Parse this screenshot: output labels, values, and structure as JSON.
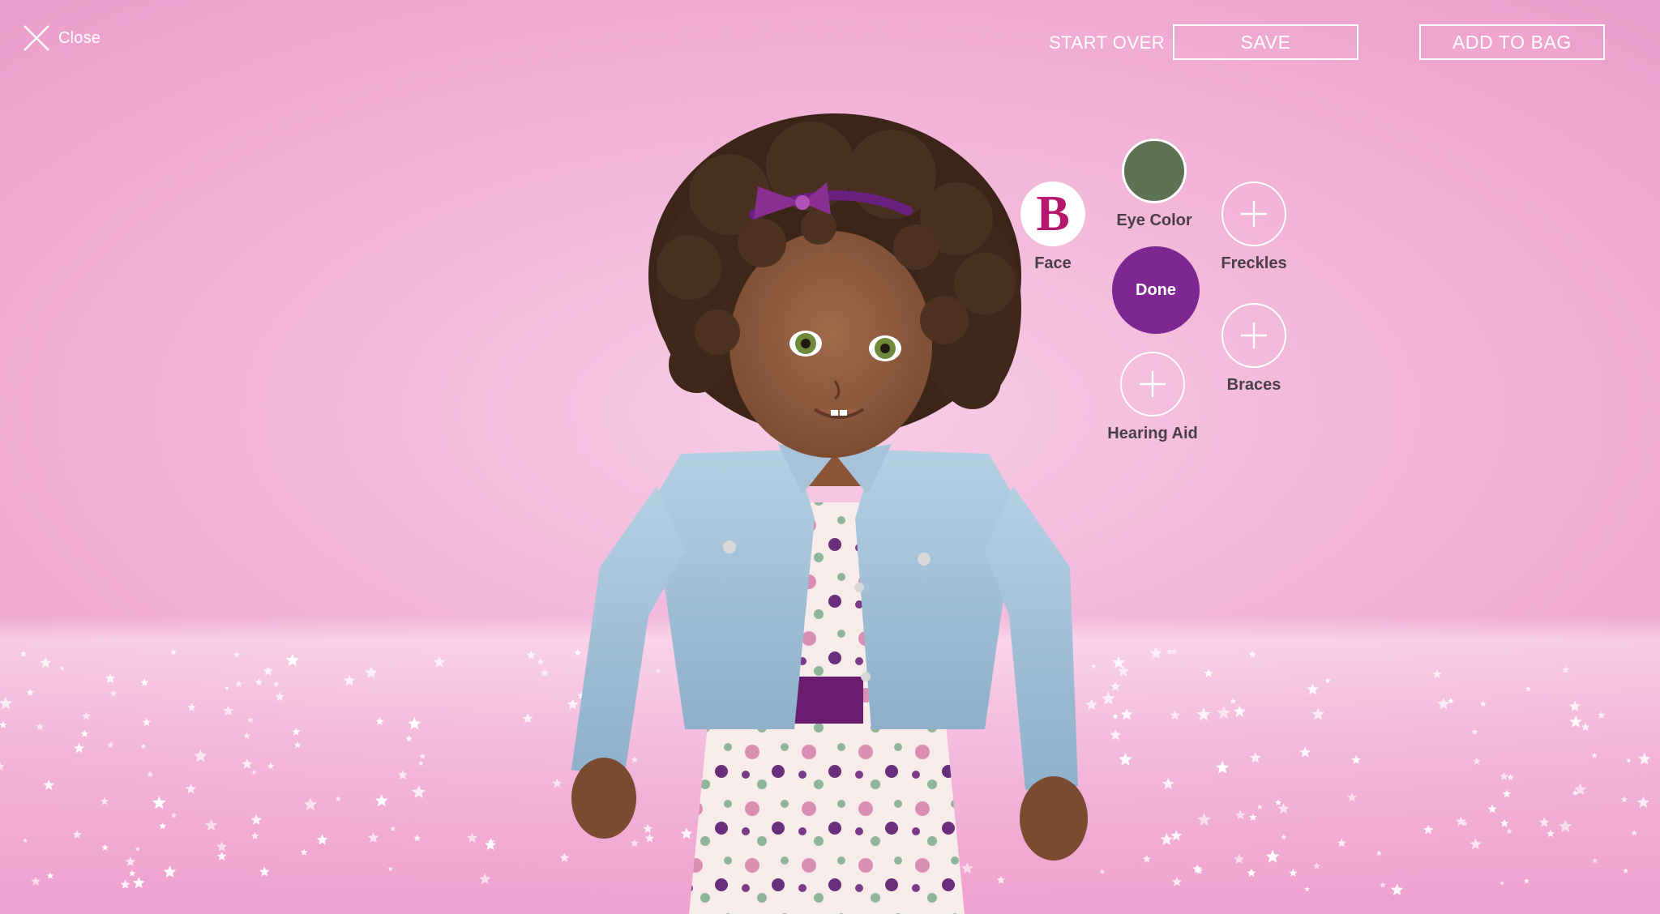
{
  "header": {
    "close_label": "Close",
    "start_over_label": "START OVER",
    "save_label": "SAVE",
    "add_to_bag_label": "ADD TO BAG"
  },
  "options": {
    "face": {
      "glyph": "B",
      "label": "Face"
    },
    "eye_color": {
      "label": "Eye Color",
      "swatch_color": "#5d7252"
    },
    "done": {
      "label": "Done",
      "color": "#7e2692"
    },
    "freckles": {
      "label": "Freckles"
    },
    "braces": {
      "label": "Braces"
    },
    "hearing_aid": {
      "label": "Hearing Aid"
    }
  },
  "icons": {
    "close": "close-icon",
    "add": "plus-icon"
  }
}
